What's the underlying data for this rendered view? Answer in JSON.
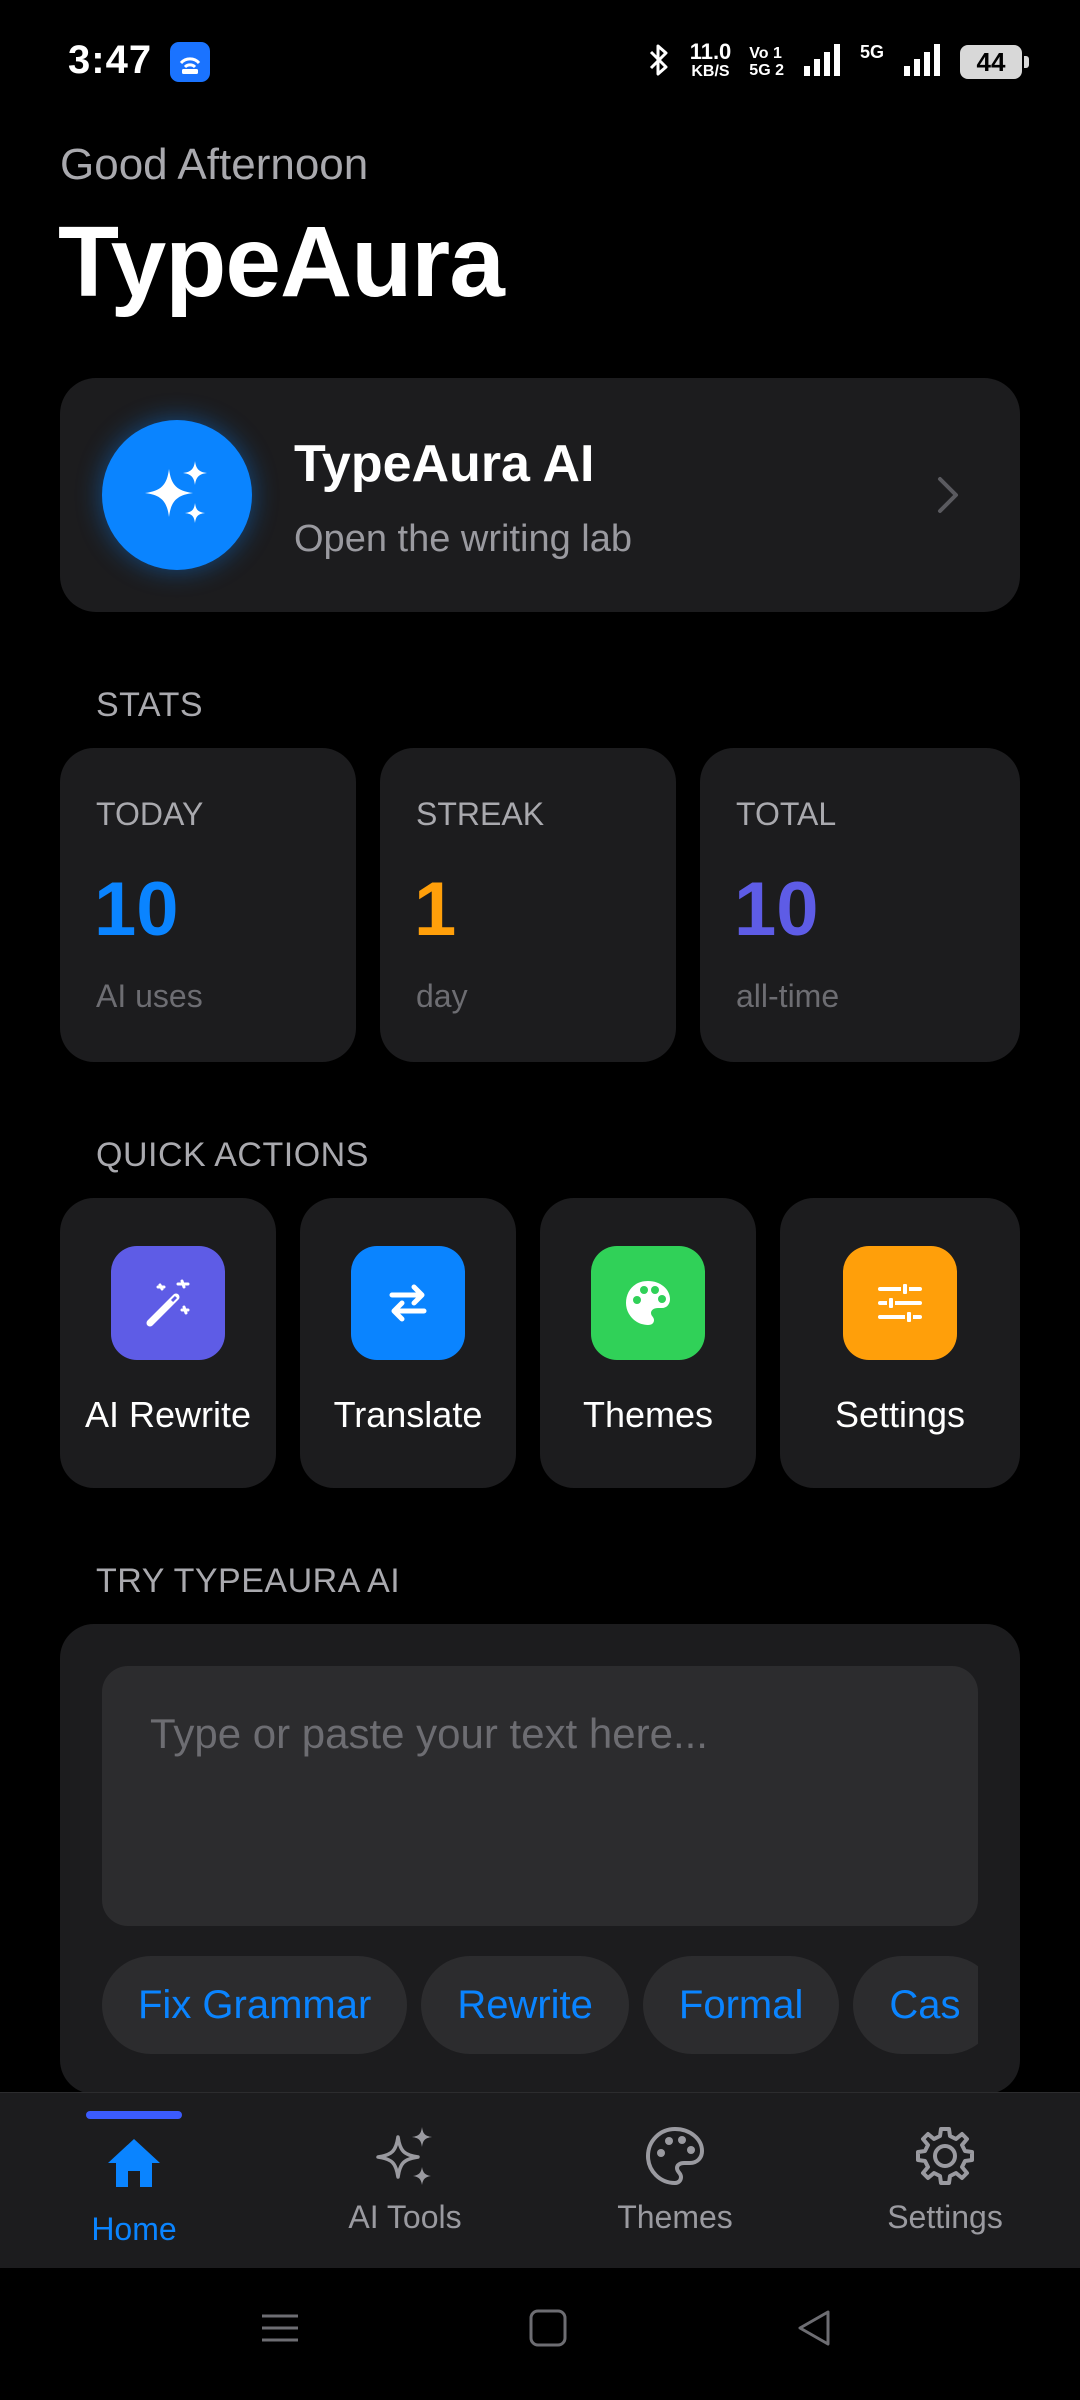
{
  "status_bar": {
    "time": "3:47",
    "net_speed": "11.0",
    "net_unit": "KB/S",
    "volte_top": "Vo 1",
    "volte_bottom": "5G 2",
    "network_type": "5G",
    "battery": "44"
  },
  "header": {
    "greeting": "Good Afternoon",
    "app_title": "TypeAura"
  },
  "ai_card": {
    "title": "TypeAura AI",
    "subtitle": "Open the writing lab",
    "icon": "sparkles-icon"
  },
  "stats": {
    "section_label": "STATS",
    "items": [
      {
        "label": "TODAY",
        "value": "10",
        "unit": "AI uses",
        "color": "#0a84ff"
      },
      {
        "label": "STREAK",
        "value": "1",
        "unit": "day",
        "color": "#ff9f0a"
      },
      {
        "label": "TOTAL",
        "value": "10",
        "unit": "all-time",
        "color": "#5e5ce6"
      }
    ]
  },
  "quick_actions": {
    "section_label": "QUICK ACTIONS",
    "items": [
      {
        "label": "AI Rewrite",
        "icon": "magic-wand-icon",
        "color": "#5e5ce6"
      },
      {
        "label": "Translate",
        "icon": "swap-arrows-icon",
        "color": "#0a84ff"
      },
      {
        "label": "Themes",
        "icon": "palette-icon",
        "color": "#30d158"
      },
      {
        "label": "Settings",
        "icon": "sliders-icon",
        "color": "#ff9f0a"
      }
    ]
  },
  "try_ai": {
    "section_label": "TRY TYPEAURA AI",
    "input_placeholder": "Type or paste your text here...",
    "chips": [
      "Fix Grammar",
      "Rewrite",
      "Formal",
      "Cas"
    ]
  },
  "bottom_nav": {
    "items": [
      {
        "label": "Home",
        "icon": "home-icon",
        "active": true
      },
      {
        "label": "AI Tools",
        "icon": "sparkles-icon",
        "active": false
      },
      {
        "label": "Themes",
        "icon": "palette-icon",
        "active": false
      },
      {
        "label": "Settings",
        "icon": "gear-icon",
        "active": false
      }
    ],
    "active_color": "#0a84ff"
  }
}
